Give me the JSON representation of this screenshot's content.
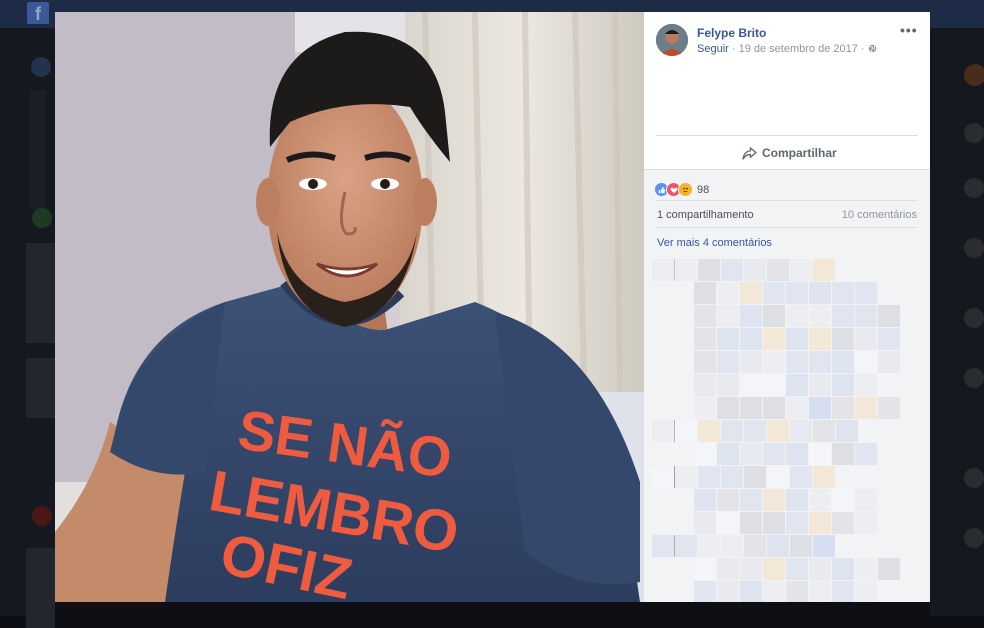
{
  "background": {
    "logo_letter": "f"
  },
  "post": {
    "author": "Felype Brito",
    "follow_label": "Seguir",
    "date": "19 de setembro de 2017",
    "privacy_icon": "globe-icon",
    "more_icon": "more-options-icon",
    "more_label": "•••",
    "share_label": "Compartilhar",
    "reactions": [
      "like-icon",
      "love-icon",
      "sad-icon"
    ],
    "reaction_count": "98",
    "shares_label": "1 compartilhamento",
    "comments_label": "10 comentários",
    "see_more_label": "Ver mais 4 comentários",
    "shirt_text": [
      "SE NÃO",
      "LEMBRO",
      "OFIZ"
    ]
  },
  "colors": {
    "link": "#365899",
    "muted": "#90949c",
    "like": "#5890ff",
    "love": "#f25268",
    "sad": "#f7b125"
  }
}
